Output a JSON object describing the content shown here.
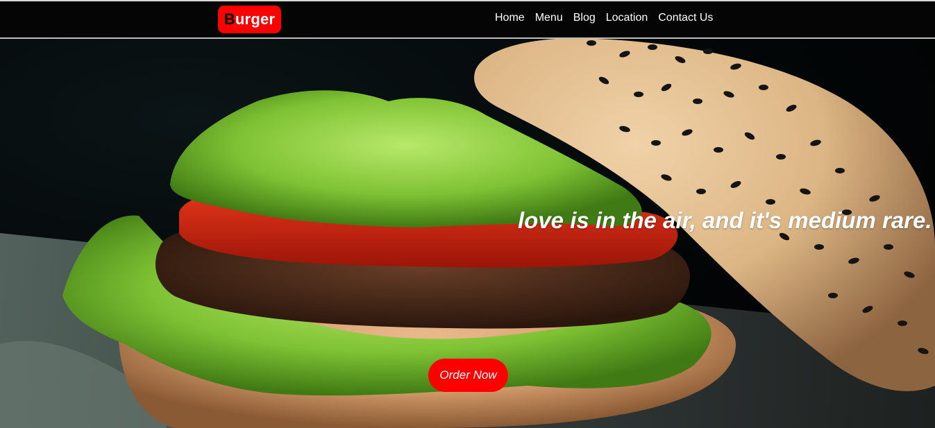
{
  "brand": {
    "first_letter": "B",
    "rest": "urger",
    "accent": "#ff0000"
  },
  "nav": {
    "items": [
      {
        "label": "Home"
      },
      {
        "label": "Menu"
      },
      {
        "label": "Blog"
      },
      {
        "label": "Location"
      },
      {
        "label": "Contact Us"
      }
    ]
  },
  "hero": {
    "tagline": "love is in the air, and it's medium rare.",
    "cta_label": "Order Now",
    "image_subject": "burger-photo"
  }
}
